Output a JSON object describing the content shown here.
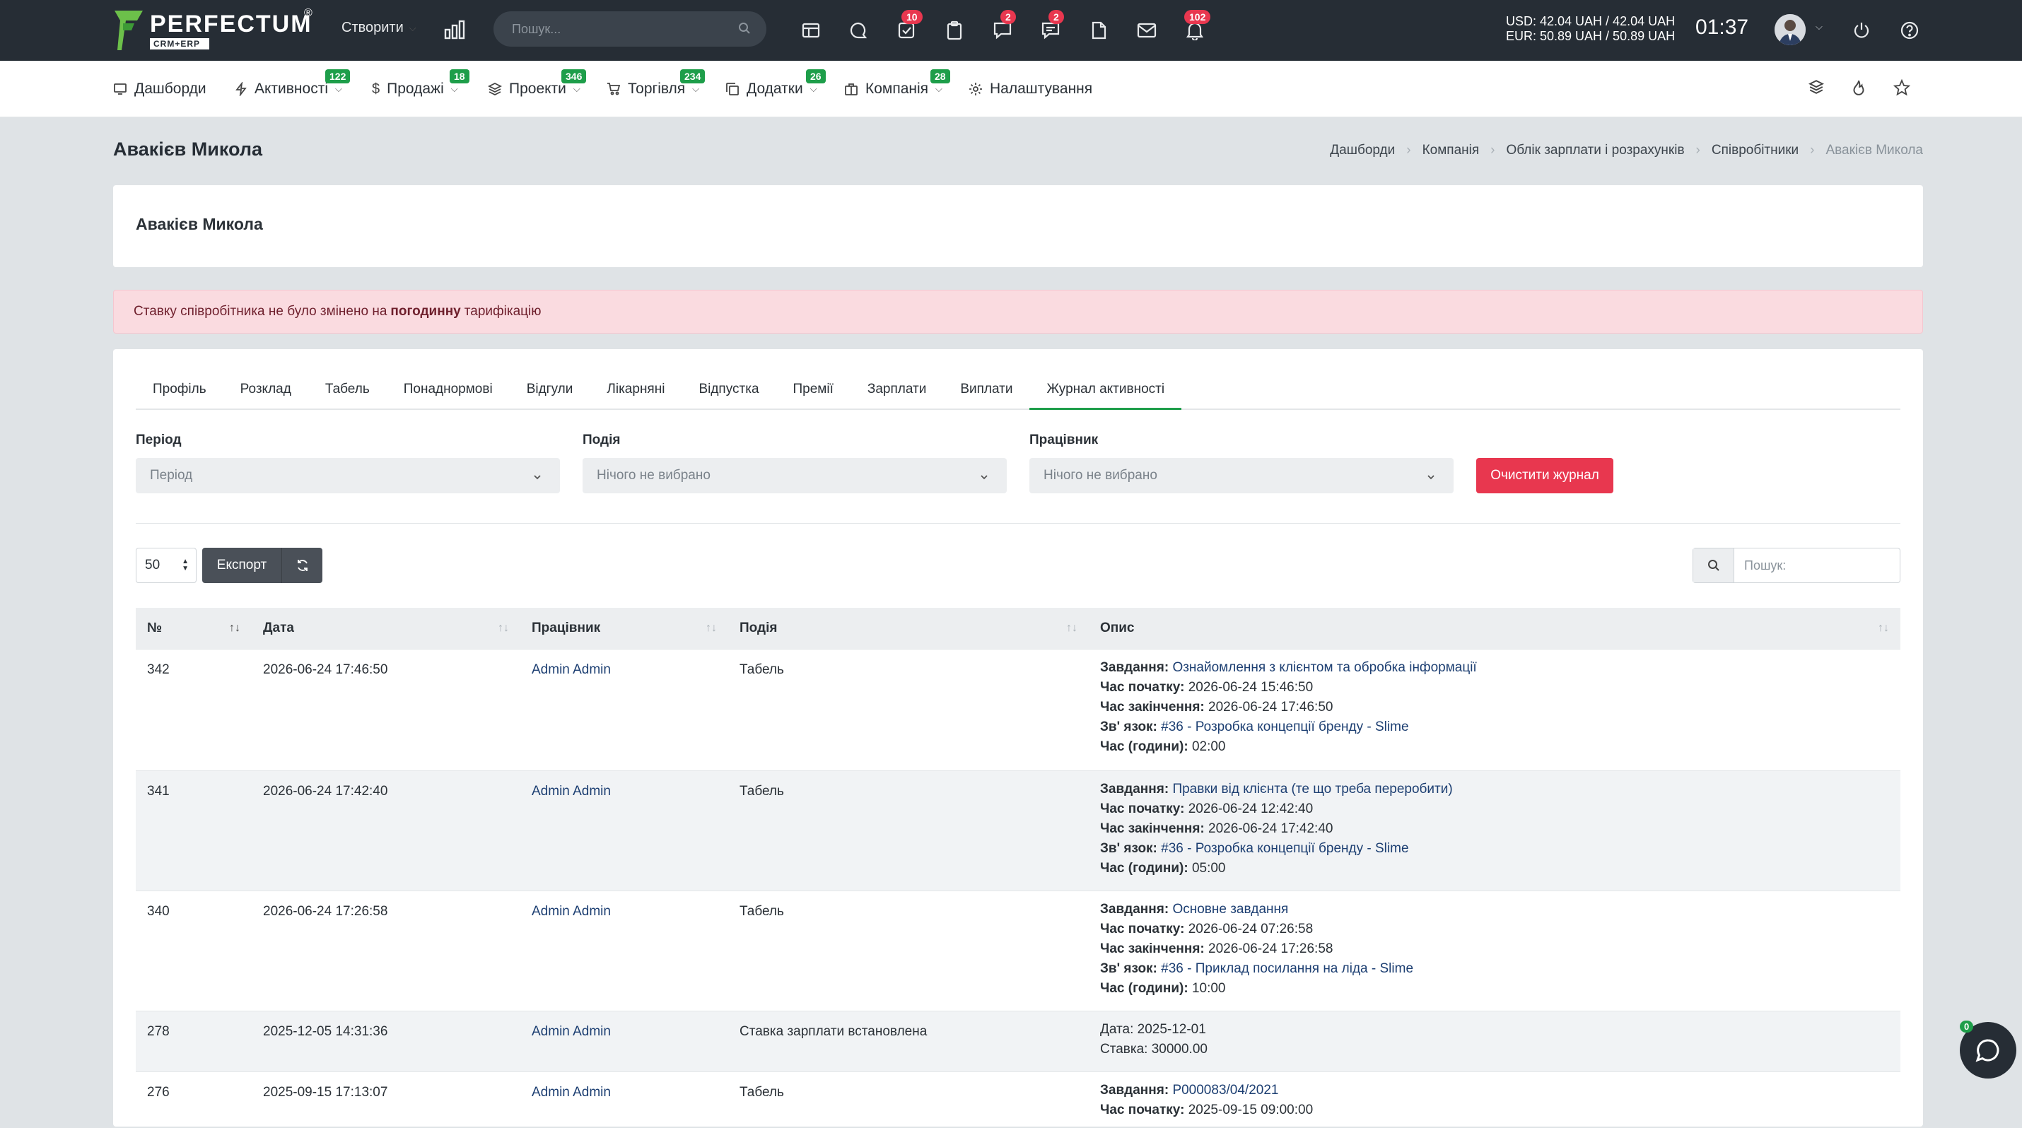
{
  "topbar": {
    "brand": "PERFECTUM",
    "brand_sub": "CRM+ERP",
    "brand_reg": "®",
    "create_label": "Створити",
    "search_placeholder": "Пошук...",
    "badges": {
      "tasks": "10",
      "chat": "2",
      "messages": "2",
      "notifications": "102"
    },
    "rate_usd": "USD: 42.04 UAH / 42.04 UAH",
    "rate_eur": "EUR: 50.89 UAH / 50.89 UAH",
    "time": "01:37"
  },
  "nav": {
    "items": [
      {
        "label": "Дашборди",
        "badge": ""
      },
      {
        "label": "Активності",
        "badge": "122"
      },
      {
        "label": "Продажі",
        "badge": "18"
      },
      {
        "label": "Проекти",
        "badge": "346"
      },
      {
        "label": "Торгівля",
        "badge": "234"
      },
      {
        "label": "Додатки",
        "badge": "26"
      },
      {
        "label": "Компанія",
        "badge": "28"
      },
      {
        "label": "Налаштування",
        "badge": ""
      }
    ]
  },
  "page": {
    "title": "Авакієв Микола",
    "card_title": "Авакієв Микола",
    "breadcrumb": [
      "Дашборди",
      "Компанія",
      "Облік зарплати і розрахунків",
      "Співробітники",
      "Авакієв Микола"
    ]
  },
  "alert": {
    "before": "Ставку співробітника не було змінено на",
    "bold": "погодинну",
    "after": "тарифікацію"
  },
  "tabs": [
    "Профіль",
    "Розклад",
    "Табель",
    "Понаднормові",
    "Відгули",
    "Лікарняні",
    "Відпустка",
    "Премії",
    "Зарплати",
    "Виплати",
    "Журнал активності"
  ],
  "filters": {
    "period_label": "Період",
    "period_placeholder": "Період",
    "event_label": "Подія",
    "event_placeholder": "Нічого не вибрано",
    "worker_label": "Працівник",
    "worker_placeholder": "Нічого не вибрано",
    "clear_button": "Очистити журнал"
  },
  "toolbar": {
    "page_size": "50",
    "export_label": "Експорт",
    "search_placeholder": "Пошук:"
  },
  "table": {
    "headers": [
      "№",
      "Дата",
      "Працівник",
      "Подія",
      "Опис"
    ],
    "rows": [
      {
        "num": "342",
        "date": "2026-06-24 17:46:50",
        "worker": "Admin Admin",
        "event": "Табель",
        "task_label": "Завдання:",
        "task": "Ознайомлення з клієнтом та обробка інформації",
        "start_label": "Час початку:",
        "start": "2026-06-24 15:46:50",
        "end_label": "Час закінчення:",
        "end": "2026-06-24 17:46:50",
        "link_label": "Зв' язок:",
        "link": "#36 - Розробка концепції бренду - Slime",
        "hours_label": "Час (години):",
        "hours": "02:00"
      },
      {
        "num": "341",
        "date": "2026-06-24 17:42:40",
        "worker": "Admin Admin",
        "event": "Табель",
        "task_label": "Завдання:",
        "task": "Правки від клієнта (те що треба переробити)",
        "start_label": "Час початку:",
        "start": "2026-06-24 12:42:40",
        "end_label": "Час закінчення:",
        "end": "2026-06-24 17:42:40",
        "link_label": "Зв' язок:",
        "link": "#36 - Розробка концепції бренду - Slime",
        "hours_label": "Час (години):",
        "hours": "05:00"
      },
      {
        "num": "340",
        "date": "2026-06-24 17:26:58",
        "worker": "Admin Admin",
        "event": "Табель",
        "task_label": "Завдання:",
        "task": "Основне завдання",
        "start_label": "Час початку:",
        "start": "2026-06-24 07:26:58",
        "end_label": "Час закінчення:",
        "end": "2026-06-24 17:26:58",
        "link_label": "Зв' язок:",
        "link": "#36 - Приклад посилання на ліда - Slime",
        "hours_label": "Час (години):",
        "hours": "10:00"
      },
      {
        "num": "278",
        "date": "2025-12-05 14:31:36",
        "worker": "Admin Admin",
        "event": "Ставка зарплати встановлена",
        "line1": "Дата: 2025-12-01",
        "line2": "Ставка: 30000.00"
      },
      {
        "num": "276",
        "date": "2025-09-15 17:13:07",
        "worker": "Admin Admin",
        "event": "Табель",
        "task_label": "Завдання:",
        "task": "P000083/04/2021",
        "start_label": "Час початку:",
        "start": "2025-09-15 09:00:00"
      }
    ]
  },
  "chat": {
    "badge": "0"
  }
}
